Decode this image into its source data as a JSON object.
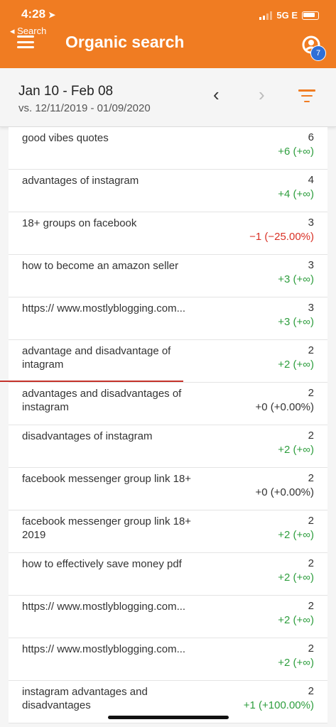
{
  "status": {
    "time": "4:28",
    "back_label": "◂ Search",
    "network": "5G E"
  },
  "header": {
    "title": "Organic search",
    "notification_count": "7"
  },
  "date": {
    "range": "Jan 10 - Feb 08",
    "compare": "vs. 12/11/2019 - 01/09/2020",
    "prev_symbol": "‹",
    "next_symbol": "›"
  },
  "rows": [
    {
      "query": "good vibes quotes",
      "count": "6",
      "change": "+6 (+∞)"
    },
    {
      "query": "advantages of instagram",
      "count": "4",
      "change": "+4 (+∞)"
    },
    {
      "query": "18+ groups on facebook",
      "count": "3",
      "change": "−1 (−25.00%)"
    },
    {
      "query": "how to become an amazon seller",
      "count": "3",
      "change": "+3 (+∞)"
    },
    {
      "query": "https:// www.mostlyblogging.com...",
      "count": "3",
      "change": "+3 (+∞)"
    },
    {
      "query": "advantage and disadvantage of intagram",
      "count": "2",
      "change": "+2 (+∞)"
    },
    {
      "query": "advantages and disadvantages of instagram",
      "count": "2",
      "change": "+0 (+0.00%)"
    },
    {
      "query": "disadvantages of instagram",
      "count": "2",
      "change": "+2 (+∞)"
    },
    {
      "query": "facebook messenger group link 18+",
      "count": "2",
      "change": "+0 (+0.00%)"
    },
    {
      "query": "facebook messenger group link 18+ 2019",
      "count": "2",
      "change": "+2 (+∞)"
    },
    {
      "query": "how to effectively save money pdf",
      "count": "2",
      "change": "+2 (+∞)"
    },
    {
      "query": "https:// www.mostlyblogging.com...",
      "count": "2",
      "change": "+2 (+∞)"
    },
    {
      "query": "https:// www.mostlyblogging.com...",
      "count": "2",
      "change": "+2 (+∞)"
    },
    {
      "query": "instagram advantages and disadvantages",
      "count": "2",
      "change": "+1 (+100.00%)"
    }
  ],
  "colors": {
    "brand": "#f07c22",
    "positive": "#2e9e3e",
    "negative": "#d93025",
    "badge": "#2f6fd6"
  }
}
